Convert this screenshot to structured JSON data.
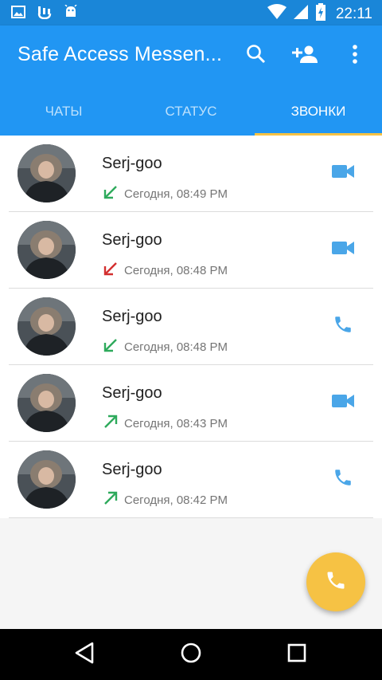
{
  "status_bar": {
    "time": "22:11",
    "icons": [
      "image-icon",
      "usb-debug-icon",
      "android-icon",
      "wifi-icon",
      "signal-icon",
      "battery-charging-icon"
    ]
  },
  "app_bar": {
    "title": "Safe Access Messen...",
    "actions": [
      "search-icon",
      "add-contact-icon",
      "more-options-icon"
    ]
  },
  "tabs": [
    {
      "label": "ЧАТЫ",
      "active": false
    },
    {
      "label": "СТАТУС",
      "active": false
    },
    {
      "label": "ЗВОНКИ",
      "active": true
    }
  ],
  "calls": [
    {
      "name": "Serj-goo",
      "time": "Сегодня, 08:49 PM",
      "direction": "incoming",
      "call_type": "video"
    },
    {
      "name": "Serj-goo",
      "time": "Сегодня, 08:48 PM",
      "direction": "missed",
      "call_type": "video"
    },
    {
      "name": "Serj-goo",
      "time": "Сегодня, 08:48 PM",
      "direction": "incoming",
      "call_type": "voice"
    },
    {
      "name": "Serj-goo",
      "time": "Сегодня, 08:43 PM",
      "direction": "outgoing",
      "call_type": "video"
    },
    {
      "name": "Serj-goo",
      "time": "Сегодня, 08:42 PM",
      "direction": "outgoing",
      "call_type": "voice"
    }
  ],
  "fab": {
    "icon": "phone-icon"
  },
  "nav_bar": {
    "buttons": [
      "back-icon",
      "home-icon",
      "recents-icon"
    ]
  },
  "colors": {
    "primary": "#2196f3",
    "status_bar": "#1a86d8",
    "accent": "#f6c244",
    "incoming_arrow": "#2eaa5c",
    "missed_arrow": "#d32f2f",
    "call_action": "#4aa6e8"
  }
}
